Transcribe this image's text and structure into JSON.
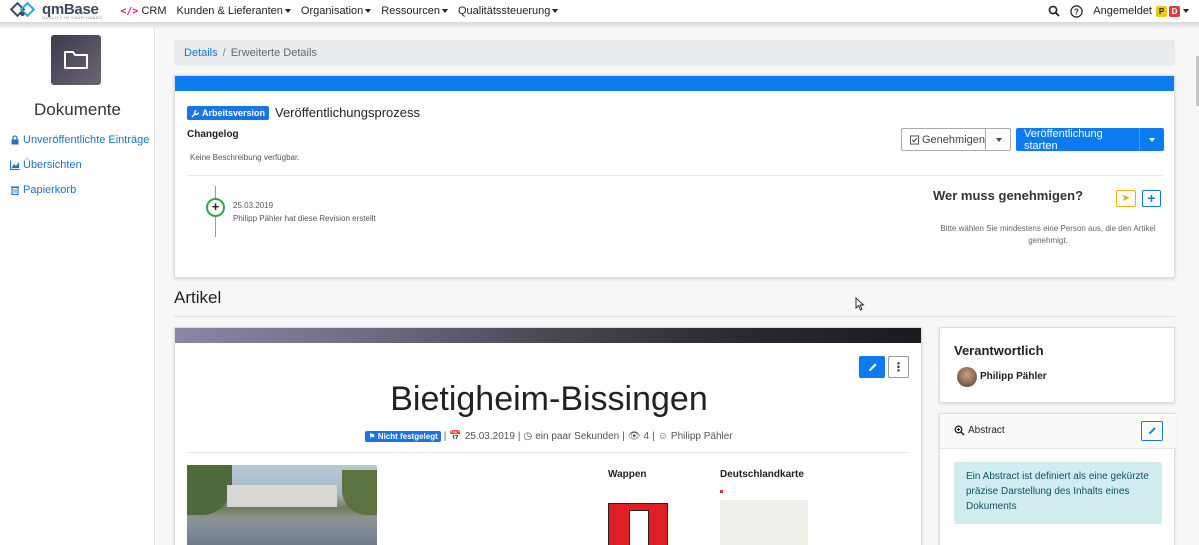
{
  "app": {
    "logo_text": "qmBase",
    "logo_tagline": "QUALITY IN YOUR HANDS"
  },
  "nav": {
    "items": [
      {
        "label": "CRM",
        "has_caret": false
      },
      {
        "label": "Kunden & Lieferanten",
        "has_caret": true
      },
      {
        "label": "Organisation",
        "has_caret": true
      },
      {
        "label": "Ressourcen",
        "has_caret": true
      },
      {
        "label": "Qualitätssteuerung",
        "has_caret": true
      }
    ],
    "user_label": "Angemeldet",
    "badges": [
      {
        "text": "P",
        "bg": "#f5c518",
        "fg": "#222"
      },
      {
        "text": "D",
        "bg": "#e03c3c",
        "fg": "#fff"
      }
    ]
  },
  "sidebar": {
    "title": "Dokumente",
    "links": [
      {
        "label": "Unveröffentlichte Einträge",
        "icon": "lock-icon"
      },
      {
        "label": "Übersichten",
        "icon": "chart-icon"
      },
      {
        "label": "Papierkorb",
        "icon": "trash-icon"
      }
    ]
  },
  "breadcrumb": {
    "link": "Details",
    "sep": "/",
    "current": "Erweiterte Details"
  },
  "workflow": {
    "badge": "Arbeitsversion",
    "title": "Veröffentlichungsprozess",
    "changelog_label": "Changelog",
    "no_description": "Keine Beschreibung verfügbar.",
    "approve_button": "Genehmigen",
    "publish_button": "Veröffentlichung starten",
    "timeline": {
      "date": "25.03.2019",
      "text": "Philipp Pähler hat diese Revision erstellt"
    },
    "approvers_title": "Wer muss genehmigen?",
    "approvers_desc": "Bitte wählen Sie mindestens eine Person aus, die den Artikel genehmigt."
  },
  "article_section": {
    "heading": "Artikel"
  },
  "article": {
    "title": "Bietigheim-Bissingen",
    "status_badge": "Nicht festgelegt",
    "date": "25.03.2019",
    "age": "ein paar Sekunden",
    "views": "4",
    "author": "Philipp Pähler",
    "wappen_label": "Wappen",
    "map_label": "Deutschlandkarte"
  },
  "responsible": {
    "title": "Verantwortlich",
    "person": "Philipp Pähler"
  },
  "abstract": {
    "title": "Abstract",
    "info": "Ein Abstract ist definiert als eine gekürzte präzise Darstellung des Inhalts eines Dokuments"
  },
  "colors": {
    "primary": "#0d7bf0",
    "success": "#2ea44f",
    "warning": "#f0b400",
    "info_bg": "#d1ecf1"
  }
}
